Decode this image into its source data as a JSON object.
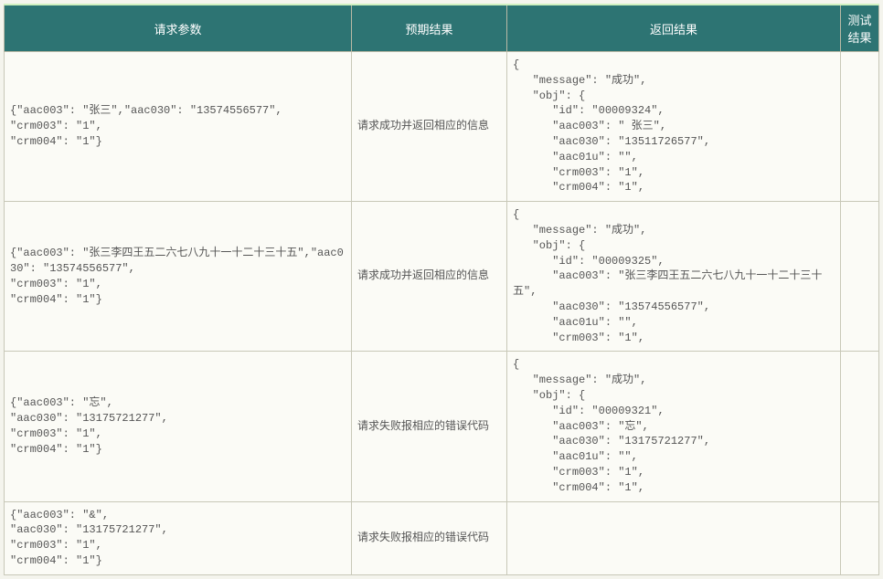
{
  "headers": {
    "request_params": "请求参数",
    "expected_result": "预期结果",
    "return_result": "返回结果",
    "test_result": "测试结果"
  },
  "rows": [
    {
      "request": "{\"aac003\": \"张三\",\"aac030\": \"13574556577\",\n\"crm003\": \"1\",\n\"crm004\": \"1\"}",
      "expected": "请求成功并返回相应的信息",
      "returned": "{\n   \"message\": \"成功\",\n   \"obj\": {\n      \"id\": \"00009324\",\n      \"aac003\": \" 张三\",\n      \"aac030\": \"13511726577\",\n      \"aac01u\": \"\",\n      \"crm003\": \"1\",\n      \"crm004\": \"1\",",
      "test": ""
    },
    {
      "request": "{\"aac003\": \"张三李四王五二六七八九十一十二十三十五\",\"aac030\": \"13574556577\",\n\"crm003\": \"1\",\n\"crm004\": \"1\"}",
      "expected": "请求成功并返回相应的信息",
      "returned": "{\n   \"message\": \"成功\",\n   \"obj\": {\n      \"id\": \"00009325\",\n      \"aac003\": \"张三李四王五二六七八九十一十二十三十五\",\n      \"aac030\": \"13574556577\",\n      \"aac01u\": \"\",\n      \"crm003\": \"1\",",
      "test": ""
    },
    {
      "request": "{\"aac003\": \"忘\",\n\"aac030\": \"13175721277\",\n\"crm003\": \"1\",\n\"crm004\": \"1\"}",
      "expected": "请求失败报相应的错误代码",
      "returned": "{\n   \"message\": \"成功\",\n   \"obj\": {\n      \"id\": \"00009321\",\n      \"aac003\": \"忘\",\n      \"aac030\": \"13175721277\",\n      \"aac01u\": \"\",\n      \"crm003\": \"1\",\n      \"crm004\": \"1\",",
      "test": ""
    },
    {
      "request": "{\"aac003\": \"&\",\n\"aac030\": \"13175721277\",\n\"crm003\": \"1\",\n\"crm004\": \"1\"}",
      "expected": "请求失败报相应的错误代码",
      "returned": "",
      "test": ""
    }
  ]
}
